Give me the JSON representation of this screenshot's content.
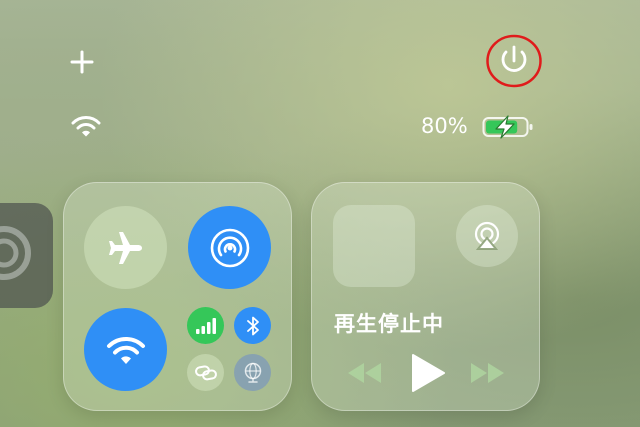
{
  "status_bar": {
    "battery_percent": "80%",
    "battery_level": 0.8,
    "wifi_connected": true
  },
  "controls": {
    "add_icon": "plus-icon",
    "power_icon": "power-icon"
  },
  "connectivity": {
    "airplane_mode": false,
    "airdrop_on": true,
    "wifi_on": true,
    "cellular_on": true,
    "bluetooth_on": true
  },
  "media": {
    "now_playing": "再生停止中",
    "playing": false
  },
  "colors": {
    "accent": "#2f8ff6",
    "cellular": "#35c759",
    "battery": "#35c759",
    "highlight_ring": "#e01b1b"
  }
}
